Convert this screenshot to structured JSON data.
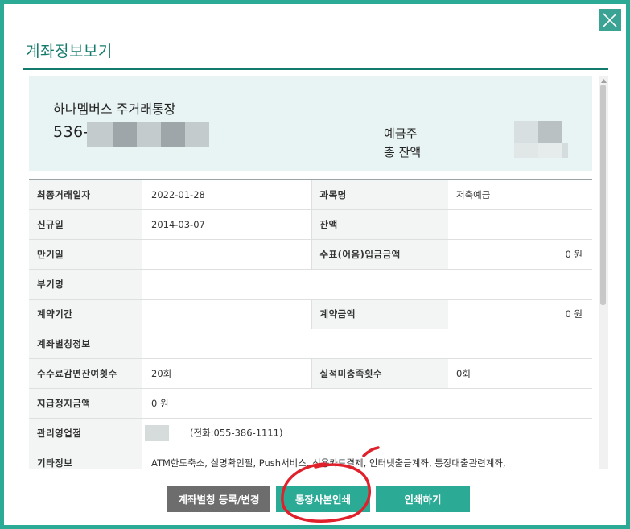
{
  "dialog": {
    "title": "계좌정보보기"
  },
  "summary": {
    "account_name": "하나멤버스 주거래통장",
    "account_number_prefix": "536-",
    "owner_label": "예금주",
    "balance_label": "총 잔액"
  },
  "table": {
    "rows": [
      {
        "label": "최종거래일자",
        "value": "2022-01-28",
        "label2": "과목명",
        "value2": "저축예금"
      },
      {
        "label": "신규일",
        "value": "2014-03-07",
        "label2": "잔액",
        "value2": ""
      },
      {
        "label": "만기일",
        "value": "",
        "label2": "수표(어음)입금금액",
        "value2": "0 원"
      },
      {
        "label": "부기명",
        "value": ""
      },
      {
        "label": "계약기간",
        "value": "",
        "label2": "계약금액",
        "value2": "0 원"
      },
      {
        "label": "계좌별칭정보",
        "value": ""
      },
      {
        "label": "수수료감면잔여횟수",
        "value": "20회",
        "label2": "실적미충족횟수",
        "value2": "0회"
      },
      {
        "label": "지급정지금액",
        "value": "0 원"
      },
      {
        "label": "관리영업점",
        "value": "(전화:055-386-1111)"
      },
      {
        "label": "기타정보",
        "value": "ATM한도축소,  실명확인필,  Push서비스,  신용카드결제,  인터넷출금계좌,  통장대출관련계좌,"
      }
    ]
  },
  "buttons": {
    "alias": "계좌별칭 등록/변경",
    "print_copy": "통장사본인쇄",
    "print": "인쇄하기"
  },
  "colors": {
    "accent": "#2bab96",
    "title": "#137a6c",
    "annotation": "#e0202a"
  }
}
